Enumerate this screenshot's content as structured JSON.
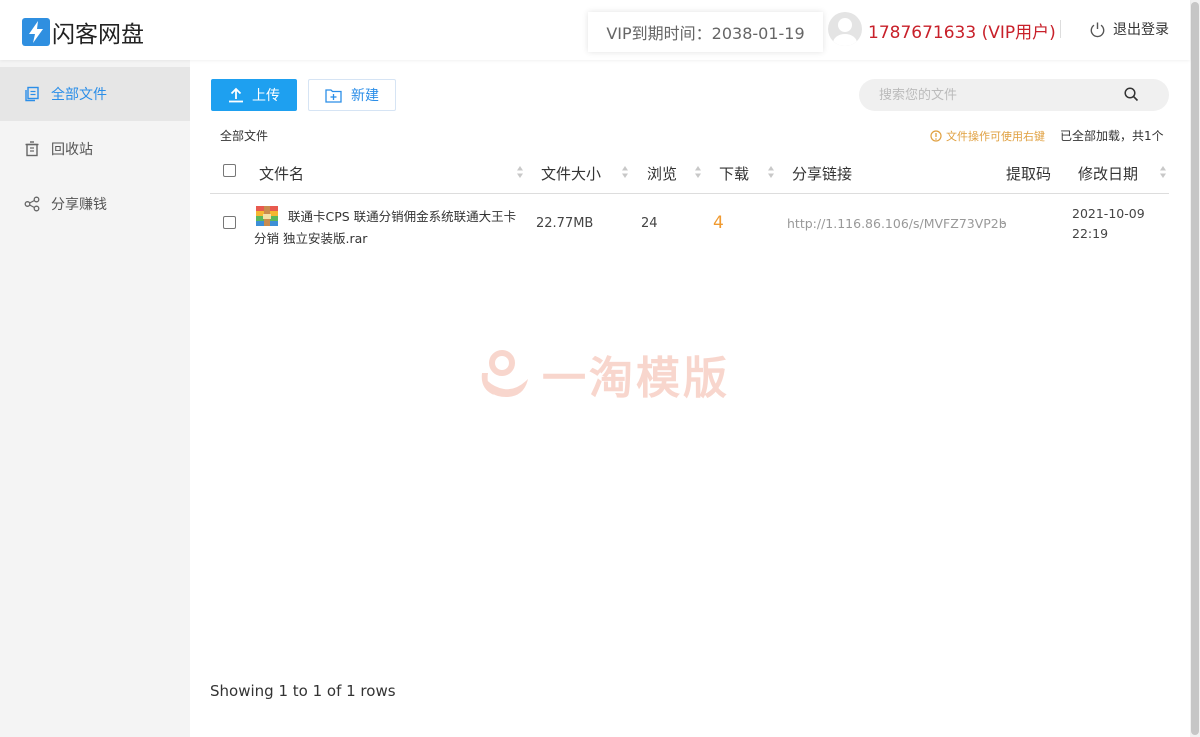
{
  "header": {
    "app_name": "闪客网盘",
    "vip_expiry": "VIP到期时间：2038-01-19",
    "user": "1787671633 (VIP用户)",
    "logout_label": "退出登录"
  },
  "sidebar": {
    "items": [
      {
        "label": "全部文件",
        "icon": "folder-icon",
        "active": true
      },
      {
        "label": "回收站",
        "icon": "trash-icon",
        "active": false
      },
      {
        "label": "分享赚钱",
        "icon": "share-icon",
        "active": false
      }
    ]
  },
  "toolbar": {
    "upload_label": "上传",
    "new_label": "新建",
    "search_placeholder": "搜索您的文件"
  },
  "breadcrumb": "全部文件",
  "hint": "文件操作可使用右键",
  "load_status": "已全部加载，共1个",
  "table": {
    "columns": [
      "文件名",
      "文件大小",
      "浏览",
      "下载",
      "分享链接",
      "提取码",
      "修改日期"
    ],
    "rows": [
      {
        "name": "联通卡CPS 联通分销佣金系统联通大王卡分销 独立安装版.rar",
        "size": "22.77MB",
        "views": "24",
        "downloads": "4",
        "share_link": "http://1.116.86.106/s/MVFZ73VP2b",
        "code": "-",
        "date": "2021-10-09",
        "time": "22:19"
      }
    ]
  },
  "footer": {
    "showing": "Showing 1 to 1 of 1 rows"
  },
  "watermark": "一淘模版",
  "colors": {
    "accent": "#1ea0f0",
    "user_name": "#c8202a",
    "download_count": "#f09a30",
    "hint": "#e0a040"
  }
}
